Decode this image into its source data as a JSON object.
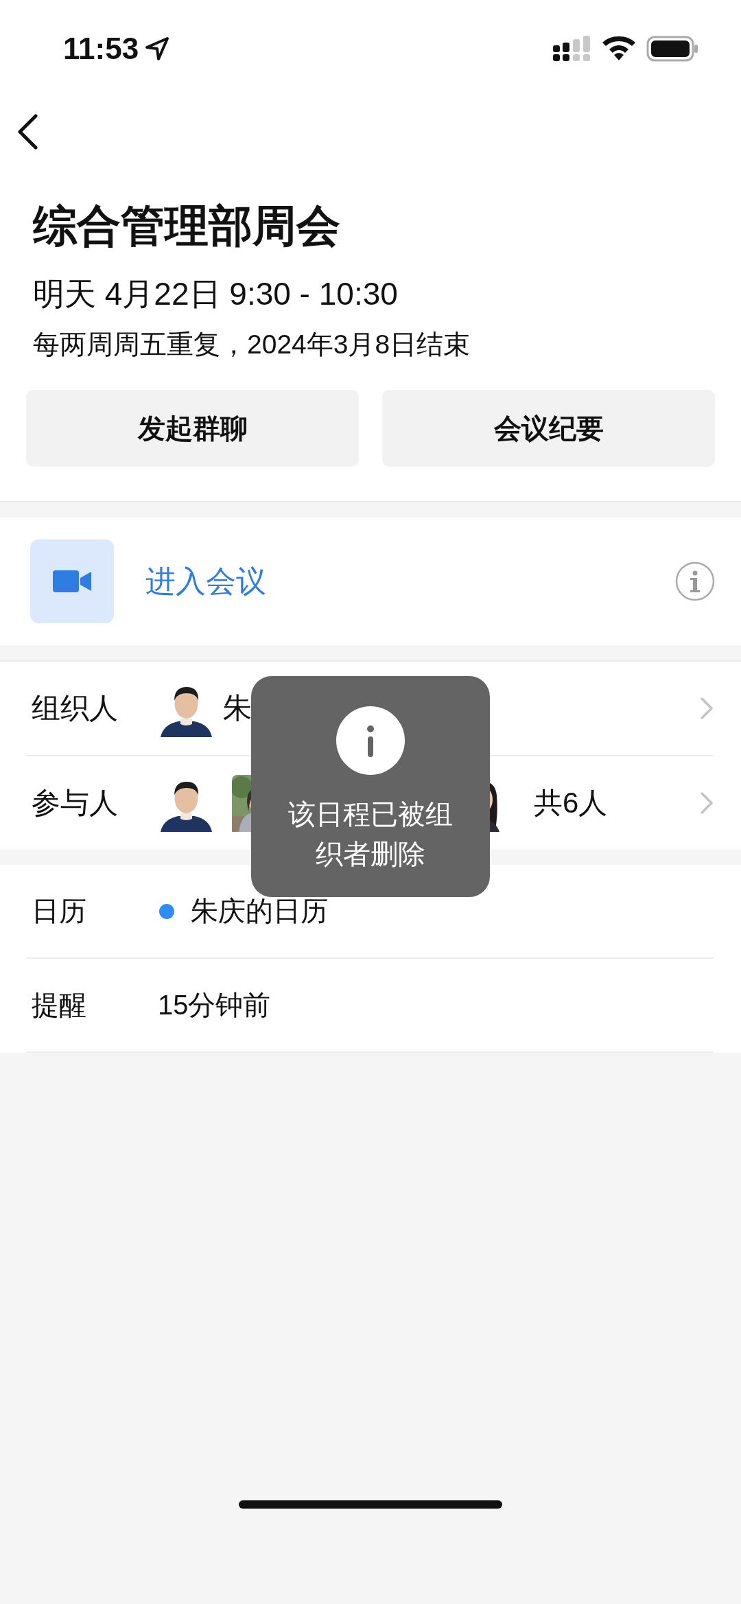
{
  "status_bar": {
    "time": "11:53"
  },
  "event": {
    "title": "综合管理部周会",
    "time": "明天 4月22日 9:30 - 10:30",
    "recurrence": "每两周周五重复，2024年3月8日结束"
  },
  "actions": [
    {
      "label": "发起群聊"
    },
    {
      "label": "会议纪要"
    }
  ],
  "meeting": {
    "label": "进入会议"
  },
  "people": [
    {
      "label": "组织人",
      "value": "朱"
    },
    {
      "label": "参与人",
      "value": "共6人"
    }
  ],
  "details": [
    {
      "kind": "calendar",
      "label": "日历",
      "value": "朱庆的日历",
      "color": "#2f8cf0"
    },
    {
      "kind": "reminder",
      "label": "提醒",
      "value": "15分钟前"
    }
  ],
  "toast": {
    "message": "该日程已被组织者删除"
  }
}
